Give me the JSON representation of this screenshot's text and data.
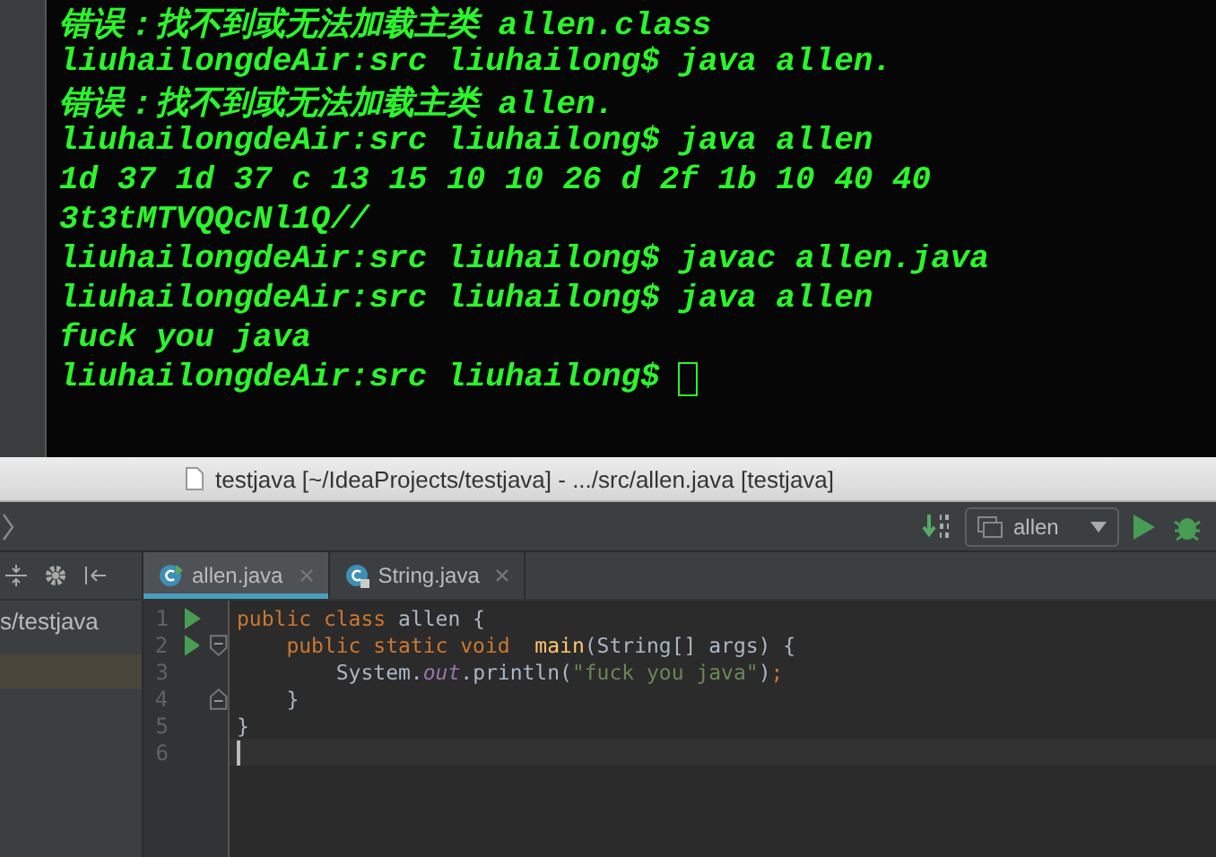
{
  "terminal": {
    "lines": [
      "错误：找不到或无法加载主类 allen.class",
      "liuhailongdeAir:src liuhailong$ java allen.",
      "错误：找不到或无法加载主类 allen.",
      "liuhailongdeAir:src liuhailong$ java allen",
      "1d 37 1d 37 c 13 15 10 10 26 d 2f 1b 10 40 40",
      "3t3tMTVQQcNl1Q//",
      "liuhailongdeAir:src liuhailong$ javac allen.java",
      "liuhailongdeAir:src liuhailong$ java allen",
      "fuck you java",
      "liuhailongdeAir:src liuhailong$"
    ],
    "cursor": true
  },
  "ide": {
    "window": {
      "title": "testjava [~/IdeaProjects/testjava] - .../src/allen.java [testjava]"
    },
    "toolbar": {
      "run_config": "allen"
    },
    "tabs": [
      {
        "label": "allen.java",
        "selected": true,
        "kind": "class"
      },
      {
        "label": "String.java",
        "selected": false,
        "kind": "library"
      }
    ],
    "project_panel": {
      "items": [
        {
          "text": "s/testjava"
        }
      ]
    },
    "editor": {
      "lines": [
        {
          "number": "1",
          "run": true,
          "fold_open": false,
          "fold_close": false,
          "current": false,
          "tokens": [
            {
              "kind": "keyword",
              "text": "public class "
            },
            {
              "kind": "plain",
              "text": "allen {"
            }
          ]
        },
        {
          "number": "2",
          "run": true,
          "fold_open": true,
          "fold_close": false,
          "current": false,
          "tokens": [
            {
              "kind": "keyword",
              "text": "    public static void  "
            },
            {
              "kind": "method",
              "text": "main"
            },
            {
              "kind": "plain",
              "text": "(String[] args) {"
            }
          ]
        },
        {
          "number": "3",
          "run": false,
          "fold_open": false,
          "fold_close": false,
          "current": false,
          "tokens": [
            {
              "kind": "plain",
              "text": "        System."
            },
            {
              "kind": "field",
              "text": "out"
            },
            {
              "kind": "plain",
              "text": ".println("
            },
            {
              "kind": "string",
              "text": "\"fuck you java\""
            },
            {
              "kind": "plain",
              "text": ")"
            },
            {
              "kind": "keyword",
              "text": ";"
            }
          ]
        },
        {
          "number": "4",
          "run": false,
          "fold_open": false,
          "fold_close": true,
          "current": false,
          "tokens": [
            {
              "kind": "plain",
              "text": "    }"
            }
          ]
        },
        {
          "number": "5",
          "run": false,
          "fold_open": false,
          "fold_close": false,
          "current": false,
          "tokens": [
            {
              "kind": "plain",
              "text": "}"
            }
          ]
        },
        {
          "number": "6",
          "run": false,
          "fold_open": false,
          "fold_close": false,
          "current": true
        }
      ]
    }
  }
}
